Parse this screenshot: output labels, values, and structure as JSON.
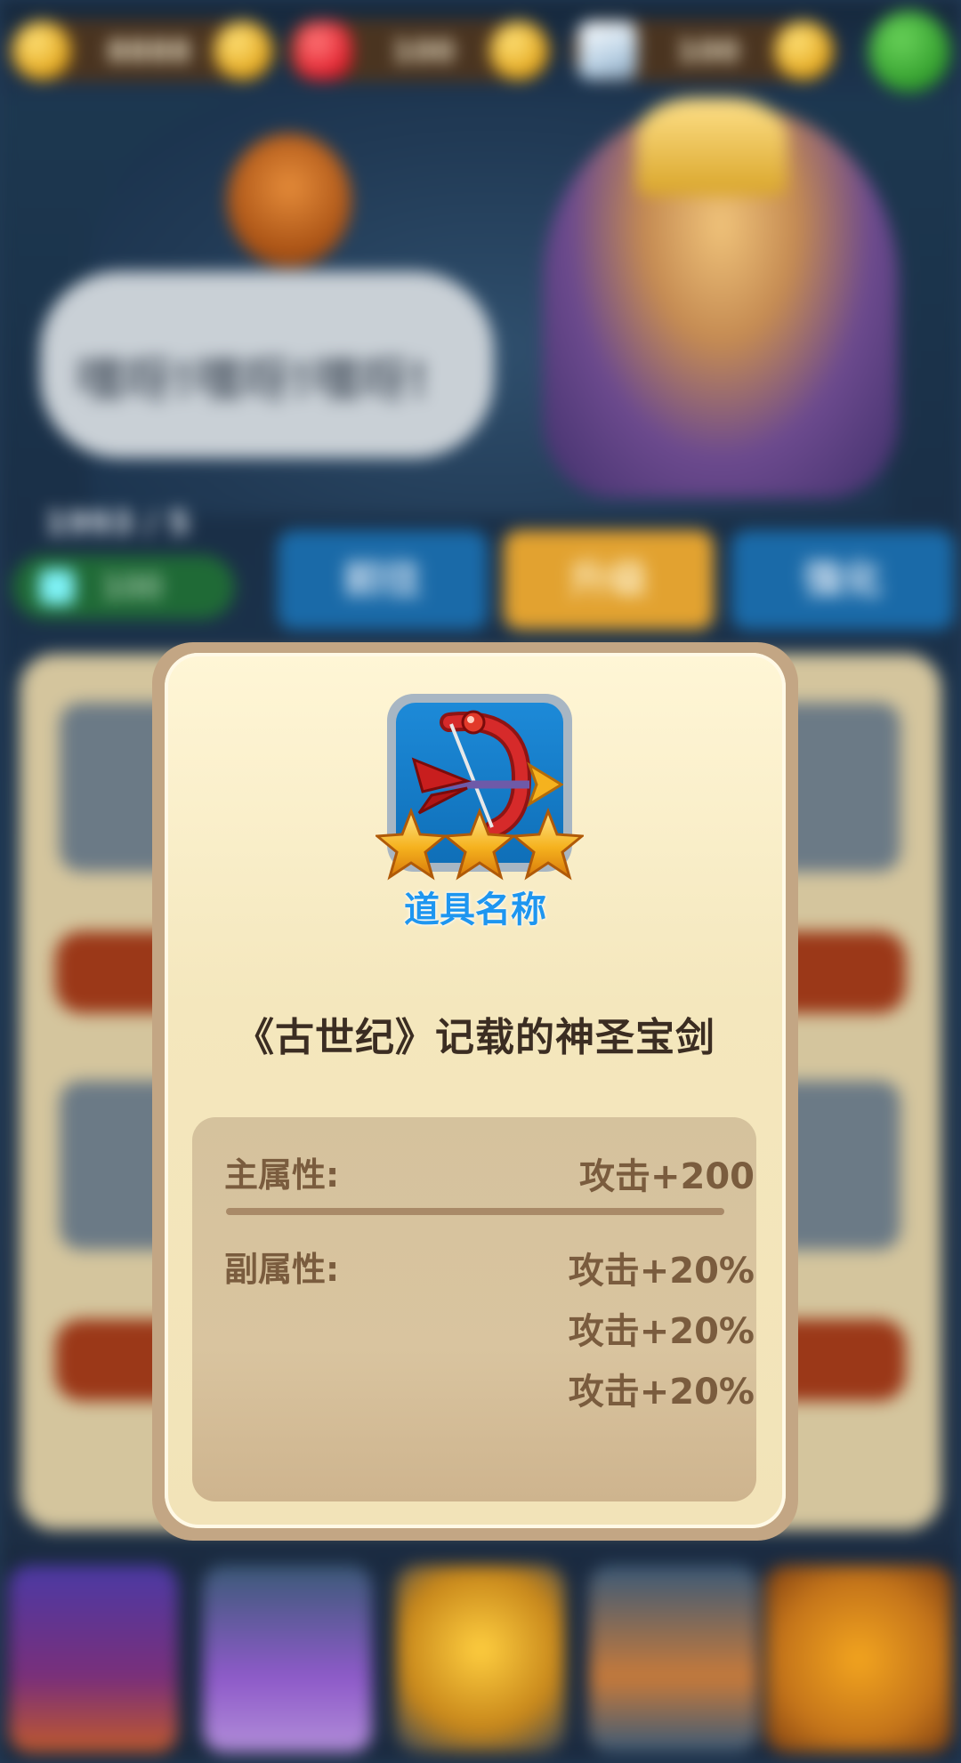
{
  "background": {
    "speech_bubble_text": "嘿呀!嘿呀!嘿呀!",
    "level_text": "1993 / 5",
    "gem_count": "100",
    "tabs": [
      "前往",
      "升级",
      "强化"
    ],
    "resources": [
      "8888",
      "100",
      "100"
    ]
  },
  "modal": {
    "item_name": "道具名称",
    "stars": 3,
    "description": "《古世纪》记载的神圣宝剑",
    "main_attr_label": "主属性:",
    "main_attr_value": "攻击+200",
    "sub_attr_label": "副属性:",
    "sub_attr_values": [
      "攻击+20%",
      "攻击+20%",
      "攻击+20%"
    ]
  },
  "icons": {
    "item": "bow-crossbow-icon",
    "star": "star-icon"
  },
  "colors": {
    "item_name": "#1e96f0",
    "modal_bg": "#f2e3b8",
    "attr_text": "#7a5c3e",
    "star": "#f5b21e"
  }
}
